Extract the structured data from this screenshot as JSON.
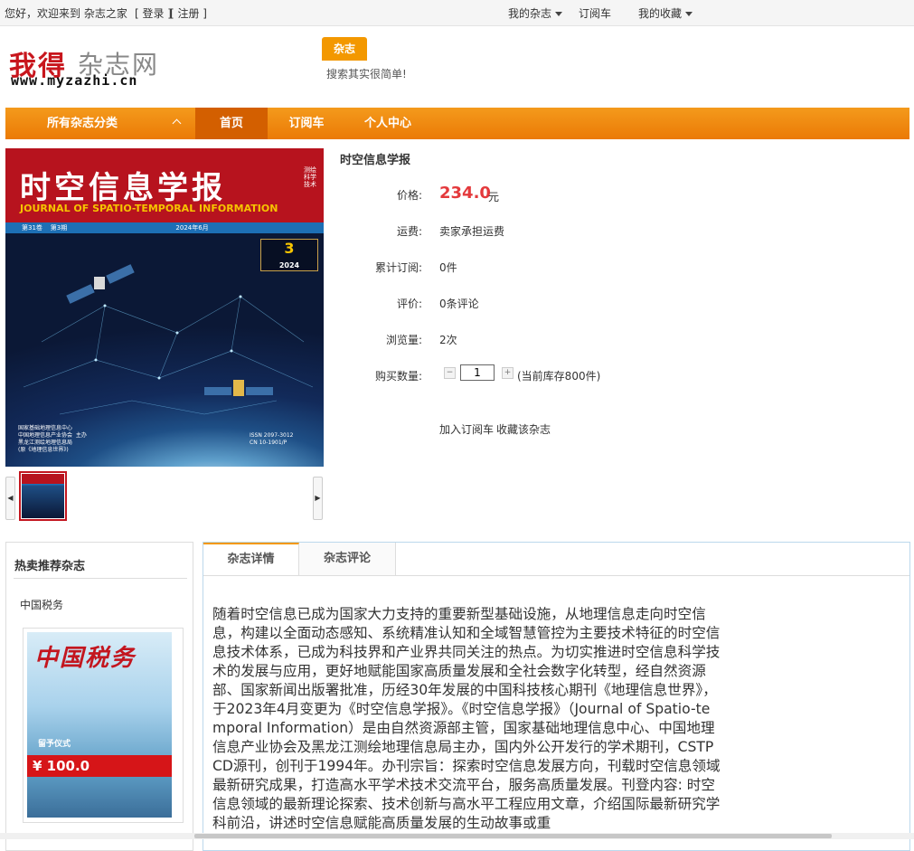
{
  "topbar": {
    "welcome": "您好，欢迎来到 杂志之家",
    "login": "[ 登录 ]",
    "register": "[ 注册 ]",
    "my_magazines": "我的杂志",
    "cart": "订阅车",
    "my_favorites": "我的收藏"
  },
  "logo": {
    "cn_red": "我得",
    "cn_gray": "杂志网",
    "url": "www.myzazhi.cn"
  },
  "search": {
    "tab_label": "杂志",
    "hint": "搜索其实很简单!"
  },
  "nav": {
    "all_categories": "所有杂志分类",
    "home": "首页",
    "cart": "订阅车",
    "user_center": "个人中心"
  },
  "product": {
    "title": "时空信息学报",
    "cover": {
      "title": "时空信息学报",
      "en_title": "JOURNAL OF SPATIO-TEMPORAL INFORMATION",
      "vertical_text": "测绘科学技术",
      "band": "第31卷    第3期                                                      2024年6月",
      "issue_no": "3",
      "issue_year": "2024",
      "footer_left": "国家基础地理信息中心\n中国地理信息产业协会  主办\n黑龙江测绘地理信息局\n(原《地理信息世界》)",
      "footer_right": "ISSN 2097-3012\nCN 10-1901/P"
    },
    "price_label": "价格:",
    "price_value": "234.0",
    "price_unit": "元",
    "shipping_label": "运费:",
    "shipping_value": "卖家承担运费",
    "subs_label": "累计订阅:",
    "subs_value": "0件",
    "review_label": "评价:",
    "review_value": "0条评论",
    "views_label": "浏览量:",
    "views_value": "2次",
    "qty_label": "购买数量:",
    "qty_value": "1",
    "stock_note": "(当前库存800件)",
    "add_to_cart": "加入订阅车",
    "favorite": "收藏该杂志"
  },
  "hot": {
    "title": "热卖推荐杂志",
    "item_name": "中国税务",
    "item_cover_title": "中国税务",
    "item_cover_caption": "留予仪式",
    "item_price": "¥ 100.0"
  },
  "tabs": {
    "detail": "杂志详情",
    "review": "杂志评论"
  },
  "description": "随着时空信息已成为国家大力支持的重要新型基础设施，从地理信息走向时空信息，构建以全面动态感知、系统精准认知和全域智慧管控为主要技术特征的时空信息技术体系，已成为科技界和产业界共同关注的热点。为切实推进时空信息科学技术的发展与应用，更好地赋能国家高质量发展和全社会数字化转型，经自然资源部、国家新闻出版署批准，历经30年发展的中国科技核心期刊《地理信息世界》，于2023年4月变更为《时空信息学报》。《时空信息学报》（Journal of Spatio-temporal Information）是由自然资源部主管，国家基础地理信息中心、中国地理信息产业协会及黑龙江测绘地理信息局主办，国内外公开发行的学术期刊，CSTPCD源刊，创刊于1994年。办刊宗旨：探索时空信息发展方向，刊载时空信息领域最新研究成果，打造高水平学术技术交流平台，服务高质量发展。刊登内容: 时空信息领域的最新理论探索、技术创新与高水平工程应用文章，介绍国际最新研究学科前沿，讲述时空信息赋能高质量发展的生动故事或重"
}
